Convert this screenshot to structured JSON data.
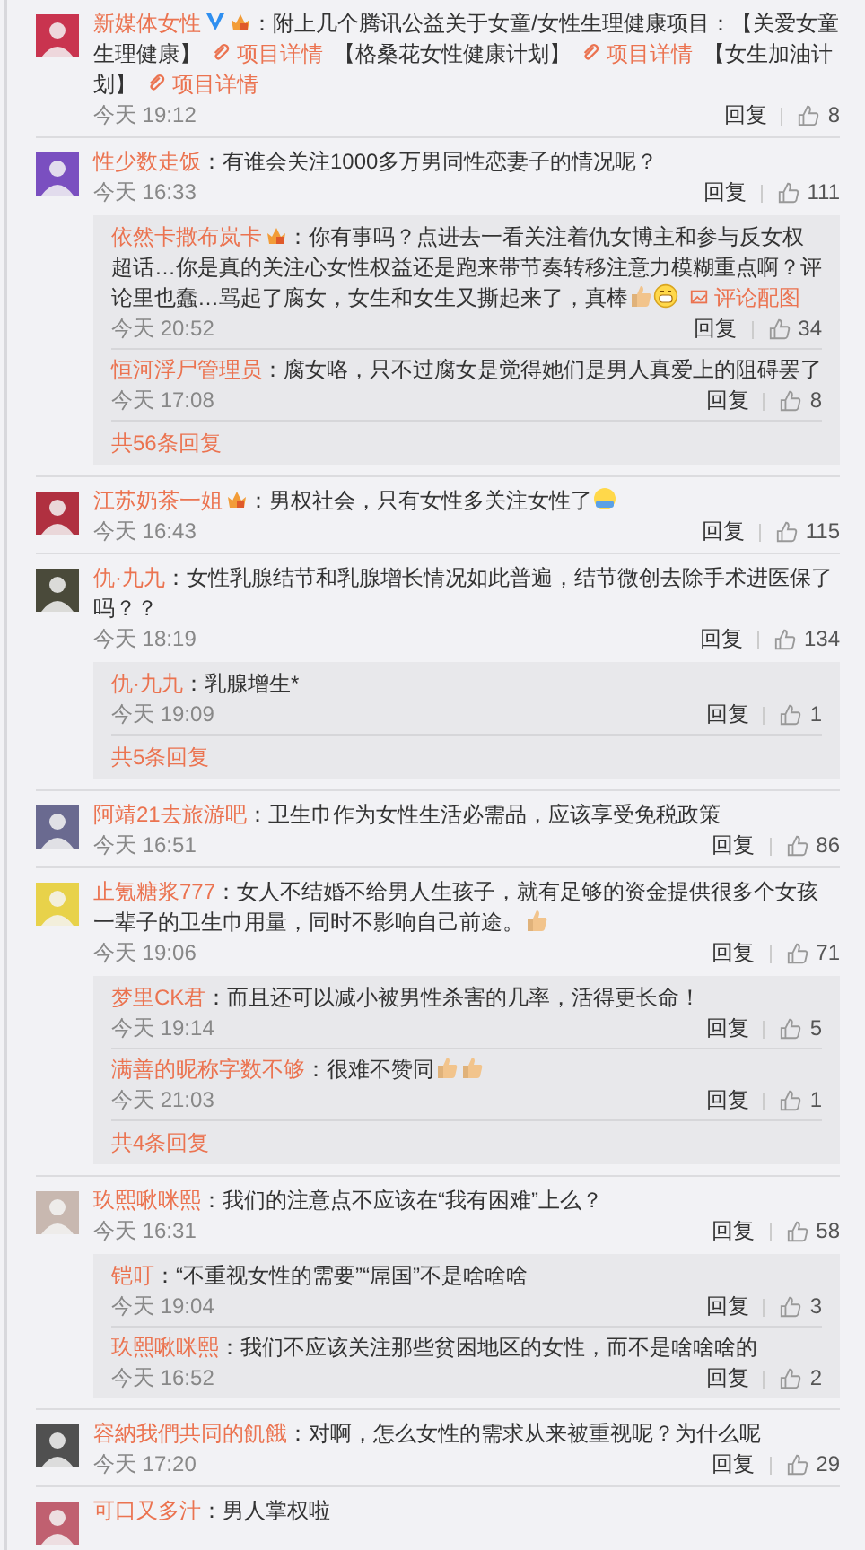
{
  "comments": [
    {
      "user": "新媒体女性",
      "verified": true,
      "vip": true,
      "content": [
        {
          "kind": "text",
          "text": "：附上几个腾讯公益关于女童/女性生理健康项目：【关爱女童生理健康】"
        },
        {
          "kind": "link",
          "text": "项目详情"
        },
        {
          "kind": "text",
          "text": "【格桑花女性健康计划】"
        },
        {
          "kind": "link",
          "text": "项目详情"
        },
        {
          "kind": "text",
          "text": "【女生加油计划】"
        },
        {
          "kind": "link",
          "text": "项目详情"
        }
      ],
      "time": "今天 19:12",
      "reply": "回复",
      "likes": "8"
    },
    {
      "user": "性少数走饭",
      "verified": false,
      "vip": false,
      "content": [
        {
          "kind": "text",
          "text": "：有谁会关注1000多万男同性恋妻子的情况呢？"
        }
      ],
      "time": "今天 16:33",
      "reply": "回复",
      "likes": "111",
      "replies": [
        {
          "user": "依然卡撒布岚卡",
          "vip": true,
          "content": [
            {
              "kind": "text",
              "text": "：你有事吗？点进去一看关注着仇女博主和参与反女权超话…你是真的关注心女性权益还是跑来带节奏转移注意力模糊重点啊？评论里也蠢…骂起了腐女，女生和女生又撕起来了，真棒"
            },
            {
              "kind": "thumb-emoji"
            },
            {
              "kind": "grin-emoji"
            },
            {
              "kind": "image-link",
              "text": "评论配图"
            }
          ],
          "time": "今天 20:52",
          "reply": "回复",
          "likes": "34"
        },
        {
          "user": "恒河浮尸管理员",
          "vip": false,
          "content": [
            {
              "kind": "text",
              "text": "：腐女咯，只不过腐女是觉得她们是男人真爱上的阻碍罢了"
            }
          ],
          "time": "今天 17:08",
          "reply": "回复",
          "likes": "8"
        }
      ],
      "more": "共56条回复"
    },
    {
      "user": "江苏奶茶一姐",
      "verified": false,
      "vip": true,
      "content": [
        {
          "kind": "text",
          "text": "：男权社会，只有女性多关注女性了"
        },
        {
          "kind": "face-emoji"
        }
      ],
      "time": "今天 16:43",
      "reply": "回复",
      "likes": "115"
    },
    {
      "user": "仇·九九",
      "verified": false,
      "vip": false,
      "content": [
        {
          "kind": "text",
          "text": "：女性乳腺结节和乳腺增长情况如此普遍，结节微创去除手术进医保了吗？？"
        }
      ],
      "time": "今天 18:19",
      "reply": "回复",
      "likes": "134",
      "replies": [
        {
          "user": "仇·九九",
          "vip": false,
          "content": [
            {
              "kind": "text",
              "text": "：乳腺增生*"
            }
          ],
          "time": "今天 19:09",
          "reply": "回复",
          "likes": "1"
        }
      ],
      "more": "共5条回复"
    },
    {
      "user": "阿靖21去旅游吧",
      "verified": false,
      "vip": false,
      "content": [
        {
          "kind": "text",
          "text": "：卫生巾作为女性生活必需品，应该享受免税政策"
        }
      ],
      "time": "今天 16:51",
      "reply": "回复",
      "likes": "86"
    },
    {
      "user": "止氪糖浆777",
      "verified": false,
      "vip": false,
      "content": [
        {
          "kind": "text",
          "text": "：女人不结婚不给男人生孩子，就有足够的资金提供很多个女孩一辈子的卫生巾用量，同时不影响自己前途。"
        },
        {
          "kind": "thumb-emoji"
        }
      ],
      "time": "今天 19:06",
      "reply": "回复",
      "likes": "71",
      "replies": [
        {
          "user": "梦里CK君",
          "vip": false,
          "content": [
            {
              "kind": "text",
              "text": "：而且还可以减小被男性杀害的几率，活得更长命！"
            }
          ],
          "time": "今天 19:14",
          "reply": "回复",
          "likes": "5"
        },
        {
          "user": "满善的昵称字数不够",
          "vip": false,
          "content": [
            {
              "kind": "text",
              "text": "：很难不赞同"
            },
            {
              "kind": "thumb-emoji"
            },
            {
              "kind": "thumb-emoji"
            }
          ],
          "time": "今天 21:03",
          "reply": "回复",
          "likes": "1"
        }
      ],
      "more": "共4条回复"
    },
    {
      "user": "玖熙啾咪熙",
      "verified": false,
      "vip": false,
      "content": [
        {
          "kind": "text",
          "text": "：我们的注意点不应该在“我有困难”上么？"
        }
      ],
      "time": "今天 16:31",
      "reply": "回复",
      "likes": "58",
      "replies": [
        {
          "user": "铠叮",
          "vip": false,
          "content": [
            {
              "kind": "text",
              "text": "：“不重视女性的需要”“屌国”不是啥啥啥"
            }
          ],
          "time": "今天 19:04",
          "reply": "回复",
          "likes": "3"
        },
        {
          "user": "玖熙啾咪熙",
          "vip": false,
          "content": [
            {
              "kind": "text",
              "text": "：我们不应该关注那些贫困地区的女性，而不是啥啥啥的"
            }
          ],
          "time": "今天 16:52",
          "reply": "回复",
          "likes": "2"
        }
      ]
    },
    {
      "user": "容納我們共同的飢餓",
      "verified": false,
      "vip": false,
      "content": [
        {
          "kind": "text",
          "text": "：对啊，怎么女性的需求从来被重视呢？为什么呢"
        }
      ],
      "time": "今天 17:20",
      "reply": "回复",
      "likes": "29"
    },
    {
      "user": "可口又多汁",
      "verified": false,
      "vip": false,
      "content": [
        {
          "kind": "text",
          "text": "：男人掌权啦"
        }
      ]
    }
  ]
}
